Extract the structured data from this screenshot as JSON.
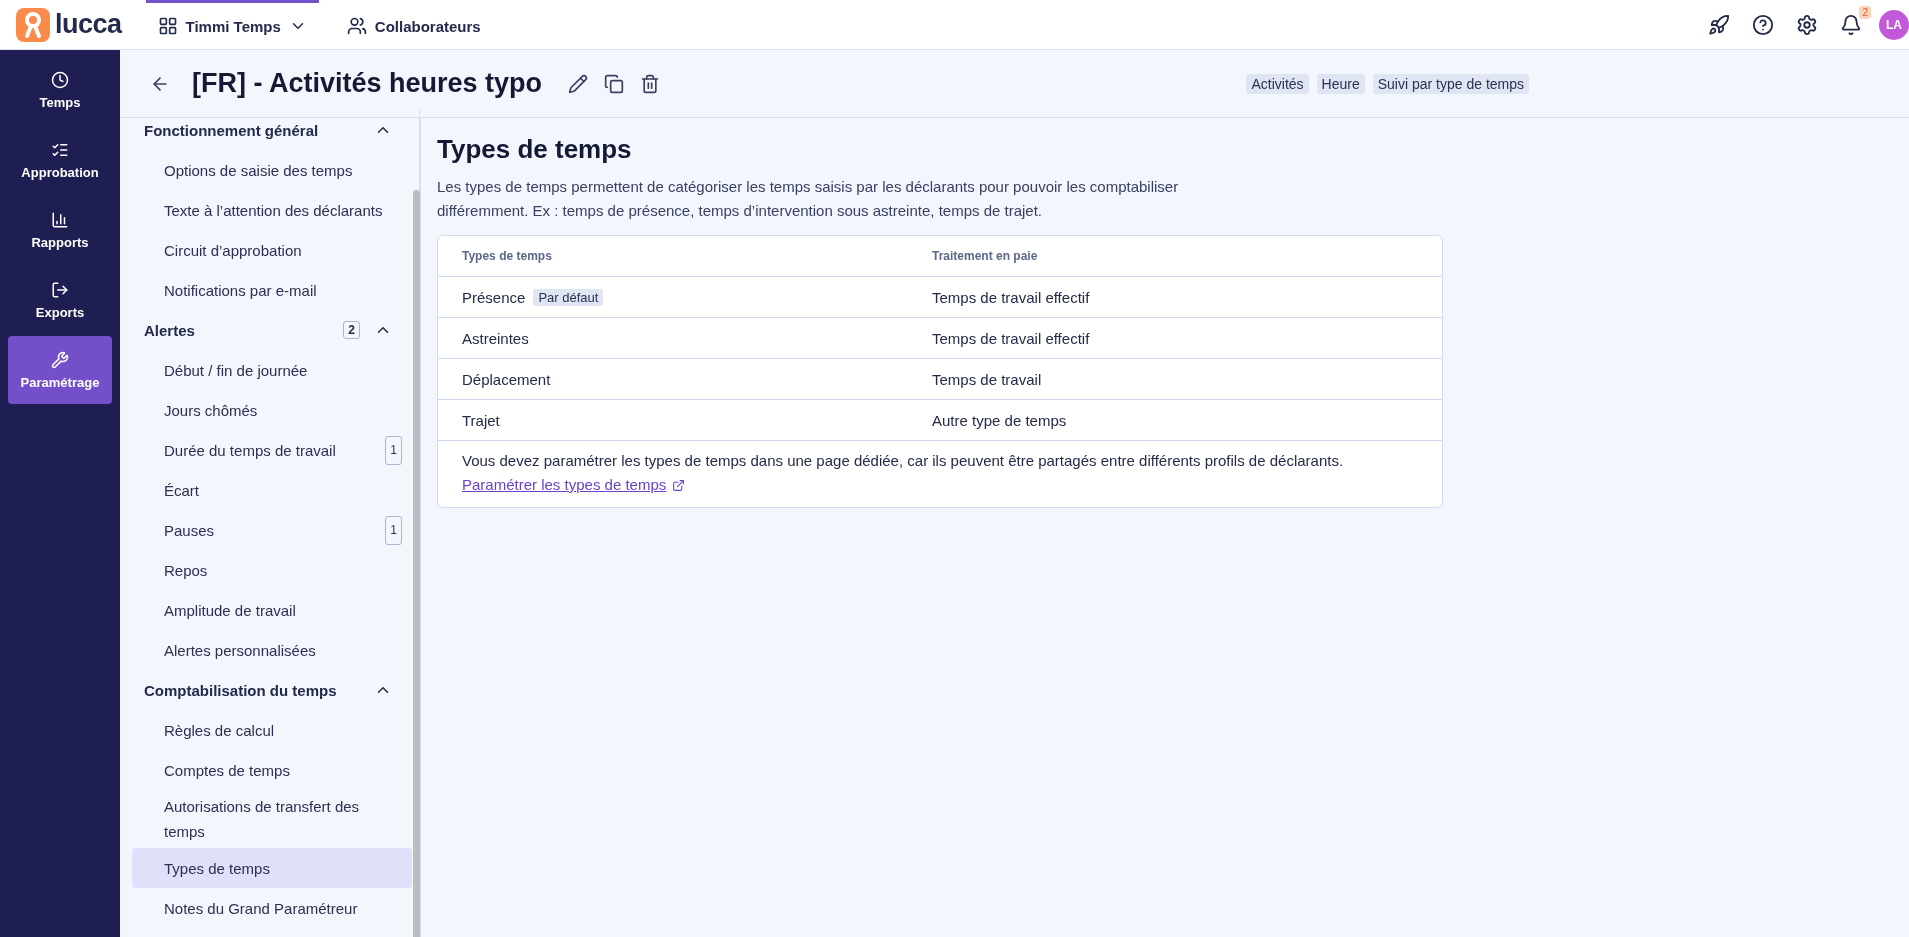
{
  "topbar": {
    "logo": "lucca",
    "apps": [
      {
        "label": "Timmi Temps",
        "selected": true,
        "kind": "dropdown"
      },
      {
        "label": "Collaborateurs",
        "selected": false,
        "kind": "link"
      }
    ],
    "notifications": "2",
    "avatar": "LA"
  },
  "nav": [
    {
      "label": "Temps",
      "selected": false
    },
    {
      "label": "Approbation",
      "selected": false
    },
    {
      "label": "Rapports",
      "selected": false
    },
    {
      "label": "Exports",
      "selected": false
    },
    {
      "label": "Paramétrage",
      "selected": true
    }
  ],
  "header": {
    "title": "[FR] - Activités heures typo",
    "tags": [
      "Activités",
      "Heure",
      "Suivi par type de temps"
    ]
  },
  "sidebar": [
    {
      "label": "Fonctionnement général",
      "expanded": true,
      "children": [
        {
          "label": "Options de saisie des temps",
          "selected": false
        },
        {
          "label": "Texte à l’attention des déclarants",
          "selected": false
        },
        {
          "label": "Circuit d’approbation",
          "selected": false
        },
        {
          "label": "Notifications par e-mail",
          "selected": false
        }
      ]
    },
    {
      "label": "Alertes",
      "count": "2",
      "expanded": true,
      "children": [
        {
          "label": "Début / fin de journée",
          "selected": false
        },
        {
          "label": "Jours chômés",
          "selected": false
        },
        {
          "label": "Durée du temps de travail",
          "count": "1",
          "selected": false
        },
        {
          "label": "Écart",
          "selected": false
        },
        {
          "label": "Pauses",
          "count": "1",
          "selected": false
        },
        {
          "label": "Repos",
          "selected": false
        },
        {
          "label": "Amplitude de travail",
          "selected": false
        },
        {
          "label": "Alertes personnalisées",
          "selected": false
        }
      ]
    },
    {
      "label": "Comptabilisation du temps",
      "expanded": true,
      "children": [
        {
          "label": "Règles de calcul",
          "selected": false
        },
        {
          "label": "Comptes de temps",
          "selected": false
        },
        {
          "label": "Autorisations de transfert des temps",
          "selected": false
        },
        {
          "label": "Types de temps",
          "selected": true
        },
        {
          "label": "Notes du Grand Paramétreur",
          "selected": false
        }
      ]
    }
  ],
  "content": {
    "title": "Types de temps",
    "description": "Les types de temps permettent de catégoriser les temps saisis par les déclarants pour pouvoir les comptabiliser différemment. Ex : temps de présence, temps d’intervention sous astreinte, temps de trajet.",
    "table": {
      "columns": [
        "Types de temps",
        "Traitement en paie"
      ],
      "rows": [
        {
          "name": "Présence",
          "tag": "Par défaut",
          "treatment": "Temps de travail effectif"
        },
        {
          "name": "Astreintes",
          "treatment": "Temps de travail effectif"
        },
        {
          "name": "Déplacement",
          "treatment": "Temps de travail"
        },
        {
          "name": "Trajet",
          "treatment": "Autre type de temps"
        }
      ],
      "note": "Vous devez paramétrer les types de temps dans une page dédiée, car ils peuvent être partagés entre différents profils de déclarants.",
      "link": "Paramétrer les types de temps"
    }
  }
}
